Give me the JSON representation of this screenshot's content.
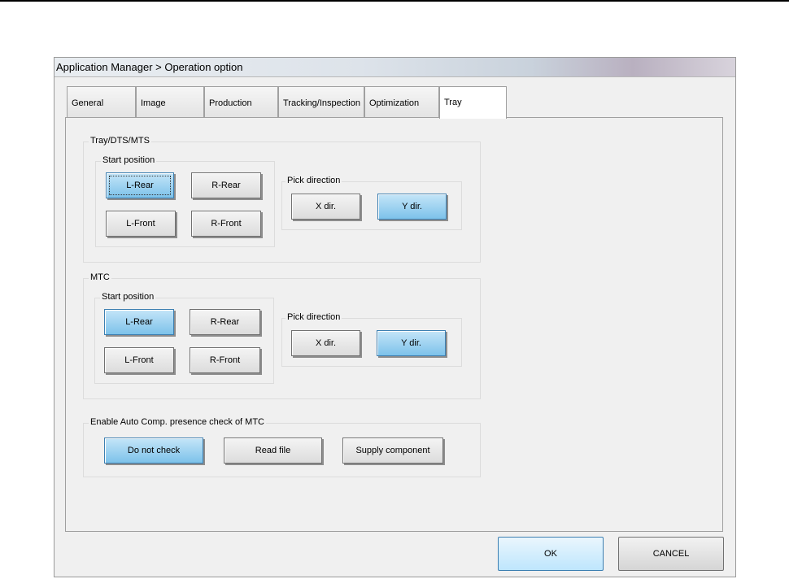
{
  "window": {
    "title": "Application Manager > Operation option"
  },
  "tabs": [
    "General",
    "Image",
    "Production",
    "Tracking/Inspection",
    "Optimization",
    "Tray"
  ],
  "active_tab": "Tray",
  "tray_group": {
    "label": "Tray/DTS/MTS",
    "start_position": {
      "label": "Start position",
      "buttons": [
        "L-Rear",
        "R-Rear",
        "L-Front",
        "R-Front"
      ],
      "selected": "L-Rear"
    },
    "pick_direction": {
      "label": "Pick direction",
      "buttons": [
        "X dir.",
        "Y dir."
      ],
      "selected": "Y dir."
    }
  },
  "mtc_group": {
    "label": "MTC",
    "start_position": {
      "label": "Start position",
      "buttons": [
        "L-Rear",
        "R-Rear",
        "L-Front",
        "R-Front"
      ],
      "selected": "L-Rear"
    },
    "pick_direction": {
      "label": "Pick direction",
      "buttons": [
        "X dir.",
        "Y dir."
      ],
      "selected": "Y dir."
    }
  },
  "auto_comp_group": {
    "label": "Enable Auto Comp. presence check of MTC",
    "buttons": [
      "Do not check",
      "Read file",
      "Supply component"
    ],
    "selected": "Do not check"
  },
  "footer": {
    "ok_label": "OK",
    "cancel_label": "CANCEL"
  },
  "colors": {
    "selected_button": "#7dc2ea",
    "panel_bg": "#f0f0f0"
  }
}
